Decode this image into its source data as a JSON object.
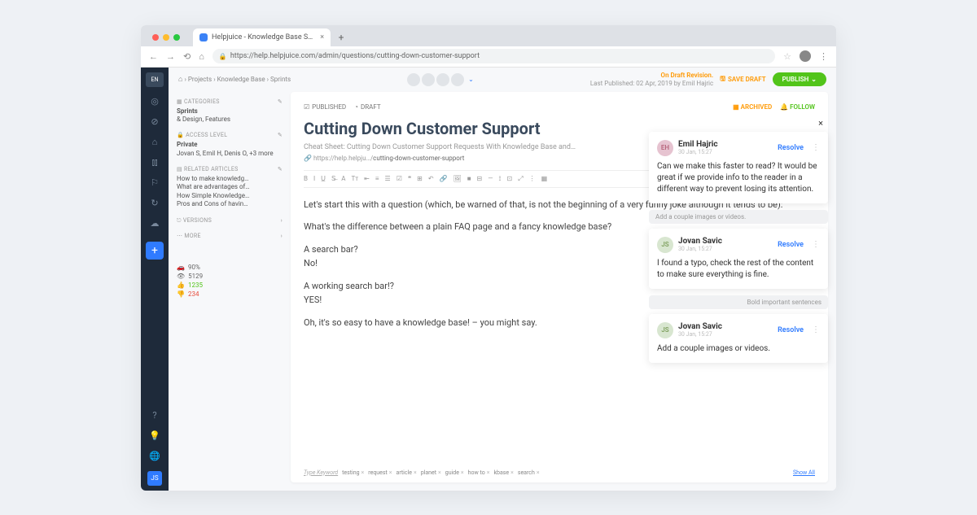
{
  "browser": {
    "tab_title": "Helpjuice - Knowledge Base S…",
    "url": "https://help.helpjuice.com/admin/questions/cutting-down-customer-support"
  },
  "rail": {
    "lang": "EN",
    "user_initials": "JS"
  },
  "topstrip": {
    "crumbs": [
      "Projects",
      "Knowledge Base",
      "Sprints"
    ],
    "status_line1": "On Draft Revision.",
    "status_line2": "Last Published: 02 Apr, 2019 by Emil Hajric",
    "save_draft": "SAVE DRAFT",
    "publish": "PUBLISH"
  },
  "side": {
    "categories": {
      "label": "CATEGORIES",
      "lines": [
        "Sprints",
        "& Design, Features"
      ]
    },
    "access": {
      "label": "ACCESS LEVEL",
      "lines": [
        "Private",
        "Jovan S, Emil H, Denis O, +3 more"
      ]
    },
    "related": {
      "label": "RELATED ARTICLES",
      "items": [
        "How to make knowledg…",
        "What are advantages of…",
        "How Simple Knowledge…",
        "Pros and Cons of havin…"
      ]
    },
    "versions": {
      "label": "VERSIONS"
    },
    "more": "MORE",
    "stats": {
      "speed": "90%",
      "views": "5129",
      "up": "1235",
      "down": "234"
    }
  },
  "editor": {
    "published_label": "PUBLISHED",
    "draft_label": "DRAFT",
    "archived_label": "ARCHIVED",
    "follow_label": "FOLLOW",
    "title": "Cutting Down Customer Support",
    "subtitle": "Cheat Sheet: Cutting Down Customer Support Requests With Knowledge Base and…",
    "url_prefix": "🔗 https://help.helpju…/",
    "url_slug": "cutting-down-customer-support",
    "paragraphs": [
      "Let's start this with a question (which, be warned of that, is not the beginning of a very funny joke although it tends to be):",
      "What's the difference between a plain FAQ page and a fancy knowledge base?",
      "A search bar?",
      "No!",
      "A working search bar!?",
      "YES!",
      "Oh, it's so easy to have a knowledge base! – you might say."
    ],
    "type_keyword": "Type Keyword",
    "tags": [
      "testing",
      "request",
      "article",
      "planet",
      "guide",
      "how to",
      "kbase",
      "search"
    ],
    "show_all": "Show All"
  },
  "comments": {
    "ghost1": "Add a couple images or videos.",
    "ghost2": "Bold important sentences",
    "items": [
      {
        "initials": "EH",
        "name": "Emil Hajric",
        "time": "30 Jan, 15:27",
        "body": "Can we make this faster to read? It would be great if we provide info to the reader in a different way to prevent losing its attention.",
        "resolve": "Resolve"
      },
      {
        "initials": "JS",
        "name": "Jovan Savic",
        "time": "30 Jan, 15:27",
        "body": "I found a typo, check the rest of the content to make sure everything is fine.",
        "resolve": "Resolve"
      },
      {
        "initials": "JS",
        "name": "Jovan Savic",
        "time": "30 Jan, 15:27",
        "body": "Add a couple images or videos.",
        "resolve": "Resolve"
      }
    ]
  }
}
